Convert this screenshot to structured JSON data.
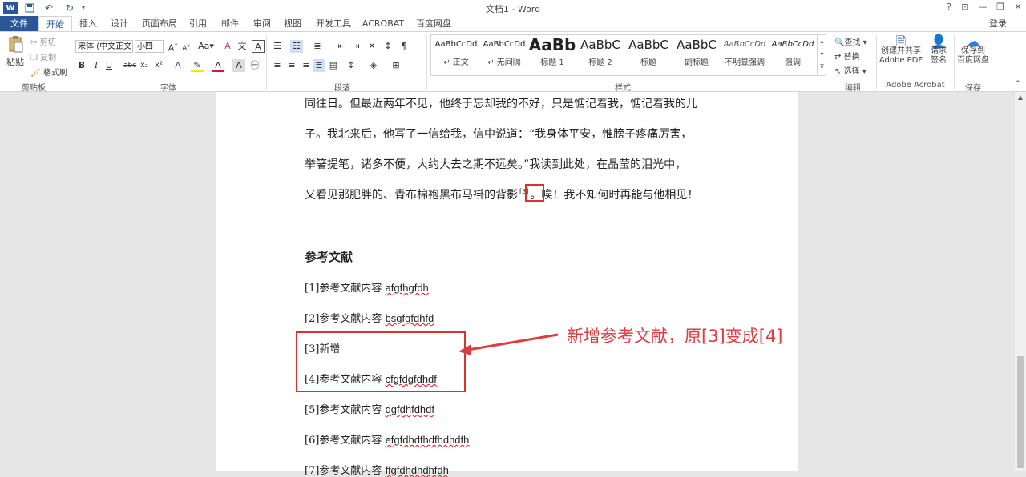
{
  "window": {
    "title": "文档1 - Word",
    "signin": "登录",
    "help": "?",
    "controls": [
      "⊡",
      "—",
      "❐",
      "✕"
    ]
  },
  "qat": [
    "W",
    "💾",
    "↶",
    "↻",
    "▾"
  ],
  "tabs": [
    "文件",
    "开始",
    "插入",
    "设计",
    "页面布局",
    "引用",
    "邮件",
    "审阅",
    "视图",
    "开发工具",
    "ACROBAT",
    "百度网盘"
  ],
  "ribbon": {
    "clipboard": {
      "paste": "粘贴",
      "cut": "剪切",
      "copy": "复制",
      "painter": "格式刷",
      "label": "剪贴板"
    },
    "font": {
      "name": "宋体 (中文正文)",
      "size": "小四",
      "label": "字体"
    },
    "paragraph": {
      "label": "段落"
    },
    "styles": {
      "label": "样式",
      "items": [
        {
          "sample": "AaBbCcDd",
          "name": "↵ 正文"
        },
        {
          "sample": "AaBbCcDd",
          "name": "↵ 无间隔"
        },
        {
          "sample": "AaBb",
          "name": "标题 1"
        },
        {
          "sample": "AaBbC",
          "name": "标题 2"
        },
        {
          "sample": "AaBbC",
          "name": "标题"
        },
        {
          "sample": "AaBbC",
          "name": "副标题"
        },
        {
          "sample": "AaBbCcDd",
          "name": "不明显强调"
        },
        {
          "sample": "AaBbCcDd",
          "name": "强调"
        }
      ]
    },
    "editing": {
      "find": "查找",
      "replace": "替换",
      "select": "选择",
      "label": "编辑"
    },
    "acrobat": {
      "create_line1": "创建并共享",
      "create_line2": "Adobe PDF",
      "sign_line1": "请求",
      "sign_line2": "签名",
      "label": "Adobe Acrobat"
    },
    "save": {
      "line1": "保存到",
      "line2": "百度网盘",
      "label": "保存"
    }
  },
  "document": {
    "paragraph_lines": [
      "同往日。但最近两年不见，他终于忘却我的不好，只是惦记着我，惦记着我的儿",
      "子。我北来后，他写了一信给我，信中说道：“我身体平安，惟膀子疼痛厉害，",
      "举箸提笔，诸多不便，大约大去之期不远矣。”我读到此处，在晶莹的泪光中，"
    ],
    "last_line_before": "又看见那肥胖的、青布棉袍黑布马褂的背影",
    "citation": "[3]",
    "last_line_after": "。唉！我不知何时再能与他相见！",
    "heading": "参考文献",
    "references": [
      {
        "num": "[1]",
        "text": "参考文献内容 ",
        "code": "afgfhgfdh"
      },
      {
        "num": "[2]",
        "text": "参考文献内容 ",
        "code": "bsgfgfdhfd"
      },
      {
        "num": "[3]",
        "text": "新增",
        "code": ""
      },
      {
        "num": "[4]",
        "text": "参考文献内容 ",
        "code": "cfgfdgfdhdf"
      },
      {
        "num": "[5]",
        "text": "参考文献内容 ",
        "code": "dgfdhfdhdf"
      },
      {
        "num": "[6]",
        "text": "参考文献内容 ",
        "code": "efgfdhdfhdfhdhdfh"
      },
      {
        "num": "[7]",
        "text": "参考文献内容 ",
        "code": "ffgfdhdhdhfdh"
      }
    ]
  },
  "annotation": "新增参考文献，原[3]变成[4]",
  "colors": {
    "accent": "#2b579a",
    "annotation": "#e0393e",
    "squiggle": "#e81123"
  }
}
